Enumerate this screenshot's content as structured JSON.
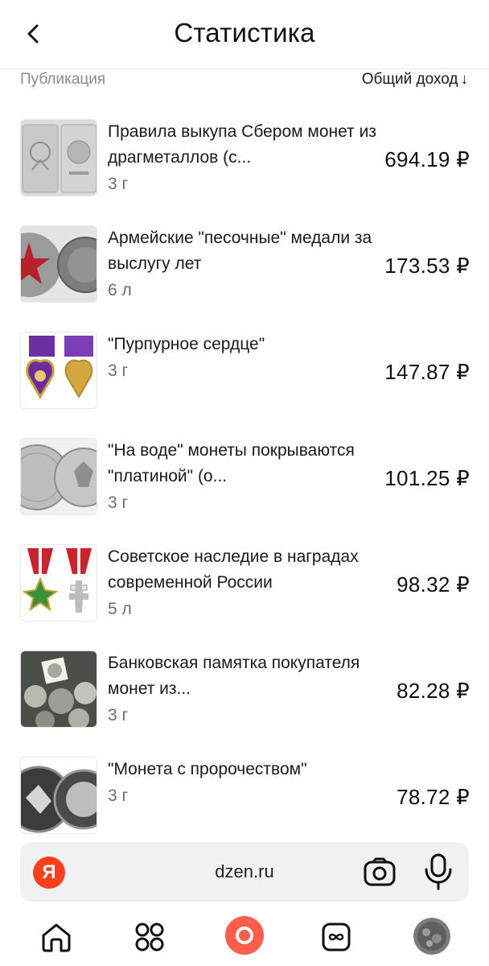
{
  "header": {
    "title": "Статистика"
  },
  "columns": {
    "publication": "Публикация",
    "income": "Общий доход",
    "sort_arrow": "↓"
  },
  "rows": [
    {
      "title": "Правила выкупа Сбером монет из драгметаллов (с...",
      "age": "3 г",
      "income": "694.19 ₽",
      "thumb": "silver-bar-coin"
    },
    {
      "title": "Армейские \"песочные\" медали за выслугу лет",
      "age": "6 л",
      "income": "173.53 ₽",
      "thumb": "red-star-medal"
    },
    {
      "title": "\"Пурпурное сердце\"",
      "age": "3 г",
      "income": "147.87 ₽",
      "thumb": "purple-heart-medal"
    },
    {
      "title": "\"На воде\" монеты покрываются \"платиной\" (о...",
      "age": "3 г",
      "income": "101.25 ₽",
      "thumb": "silver-coins"
    },
    {
      "title": "Советское наследие в наградах современной России",
      "age": "5 л",
      "income": "98.32 ₽",
      "thumb": "red-ribbon-orders"
    },
    {
      "title": "Банковская памятка покупателя монет из...",
      "age": "3 г",
      "income": "82.28 ₽",
      "thumb": "coins-pile"
    },
    {
      "title": "\"Монета с пророчеством\"",
      "age": "3 г",
      "income": "78.72 ₽",
      "thumb": "dark-coins"
    }
  ],
  "browser": {
    "logo": "Я",
    "url": "dzen.ru"
  },
  "colors": {
    "yandex_red": "#fc3f1d",
    "alice_coral": "#ff5e4c"
  },
  "nav": {
    "items": [
      "home-icon",
      "apps-grid-icon",
      "alice-icon",
      "subscriptions-icon",
      "profile-avatar"
    ]
  }
}
